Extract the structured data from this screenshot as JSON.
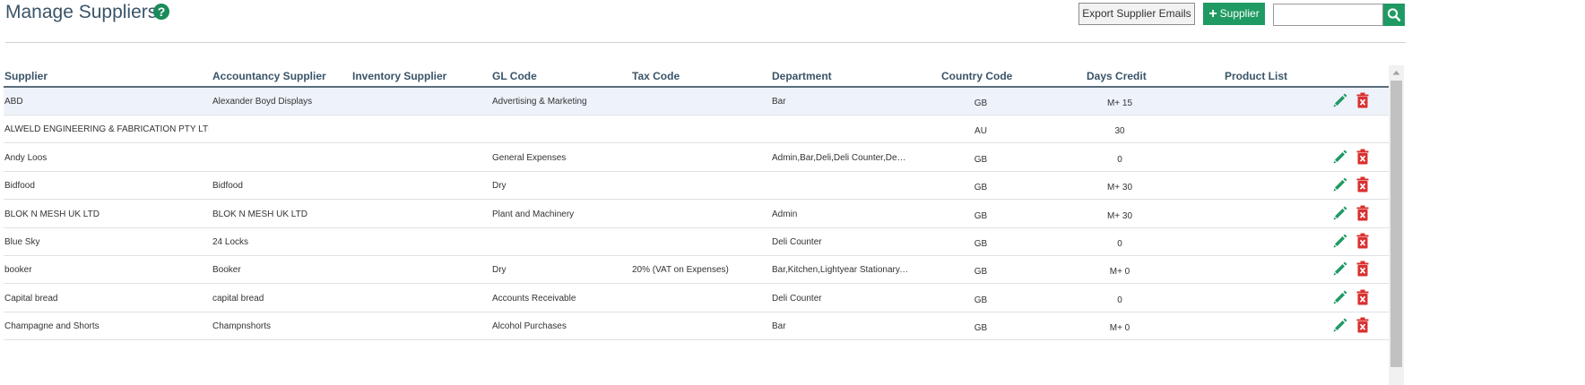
{
  "page": {
    "title": "Manage Suppliers"
  },
  "header": {
    "help_icon": "question-circle-icon",
    "help_glyph": "?",
    "export_label": "Export Supplier Emails",
    "add_label": "Supplier",
    "add_glyph": "+",
    "search_value": "",
    "search_placeholder": ""
  },
  "colors": {
    "accent": "#1f9a63",
    "heading": "#3a5468",
    "delete": "#d9302f",
    "highlight": "#eef3fb"
  },
  "table": {
    "columns": {
      "supplier": "Supplier",
      "accountancy": "Accountancy Supplier",
      "inventory": "Inventory Supplier",
      "gl_code": "GL Code",
      "tax_code": "Tax Code",
      "department": "Department",
      "country_code": "Country Code",
      "days_credit": "Days Credit",
      "product_list": "Product List"
    },
    "rows": [
      {
        "supplier": "ABD",
        "accountancy": "Alexander Boyd Displays",
        "inventory": "",
        "gl_code": "Advertising & Marketing",
        "tax_code": "",
        "department": "Bar",
        "country": "GB",
        "days": "M+ 15",
        "product": "",
        "actions": true
      },
      {
        "supplier": "ALWELD ENGINEERING & FABRICATION PTY LTD",
        "accountancy": "",
        "inventory": "",
        "gl_code": "",
        "tax_code": "",
        "department": "",
        "country": "AU",
        "days": "30",
        "product": "",
        "actions": false
      },
      {
        "supplier": "Andy Loos",
        "accountancy": "",
        "inventory": "",
        "gl_code": "General Expenses",
        "tax_code": "",
        "department": "Admin,Bar,Deli,Deli Counter,Dem...",
        "country": "GB",
        "days": "0",
        "product": "",
        "actions": true
      },
      {
        "supplier": "Bidfood",
        "accountancy": "Bidfood",
        "inventory": "",
        "gl_code": "Dry",
        "tax_code": "",
        "department": "",
        "country": "GB",
        "days": "M+ 30",
        "product": "",
        "actions": true
      },
      {
        "supplier": "BLOK N MESH UK LTD",
        "accountancy": "BLOK N MESH UK LTD",
        "inventory": "",
        "gl_code": "Plant and Machinery",
        "tax_code": "",
        "department": "Admin",
        "country": "GB",
        "days": "M+ 30",
        "product": "",
        "actions": true
      },
      {
        "supplier": "Blue Sky",
        "accountancy": "24 Locks",
        "inventory": "",
        "gl_code": "",
        "tax_code": "",
        "department": "Deli Counter",
        "country": "GB",
        "days": "0",
        "product": "",
        "actions": true
      },
      {
        "supplier": "booker",
        "accountancy": "Booker",
        "inventory": "",
        "gl_code": "Dry",
        "tax_code": "20% (VAT on Expenses)",
        "department": "Bar,Kitchen,Lightyear Stationary,...",
        "country": "GB",
        "days": "M+ 0",
        "product": "",
        "actions": true
      },
      {
        "supplier": "Capital bread",
        "accountancy": "capital bread",
        "inventory": "",
        "gl_code": "Accounts Receivable",
        "tax_code": "",
        "department": "Deli Counter",
        "country": "GB",
        "days": "0",
        "product": "",
        "actions": true
      },
      {
        "supplier": "Champagne and Shorts",
        "accountancy": "Champnshorts",
        "inventory": "",
        "gl_code": "Alcohol Purchases",
        "tax_code": "",
        "department": "Bar",
        "country": "GB",
        "days": "M+ 0",
        "product": "",
        "actions": true
      }
    ],
    "edit_icon": "pencil-icon",
    "delete_icon": "delete-icon"
  }
}
